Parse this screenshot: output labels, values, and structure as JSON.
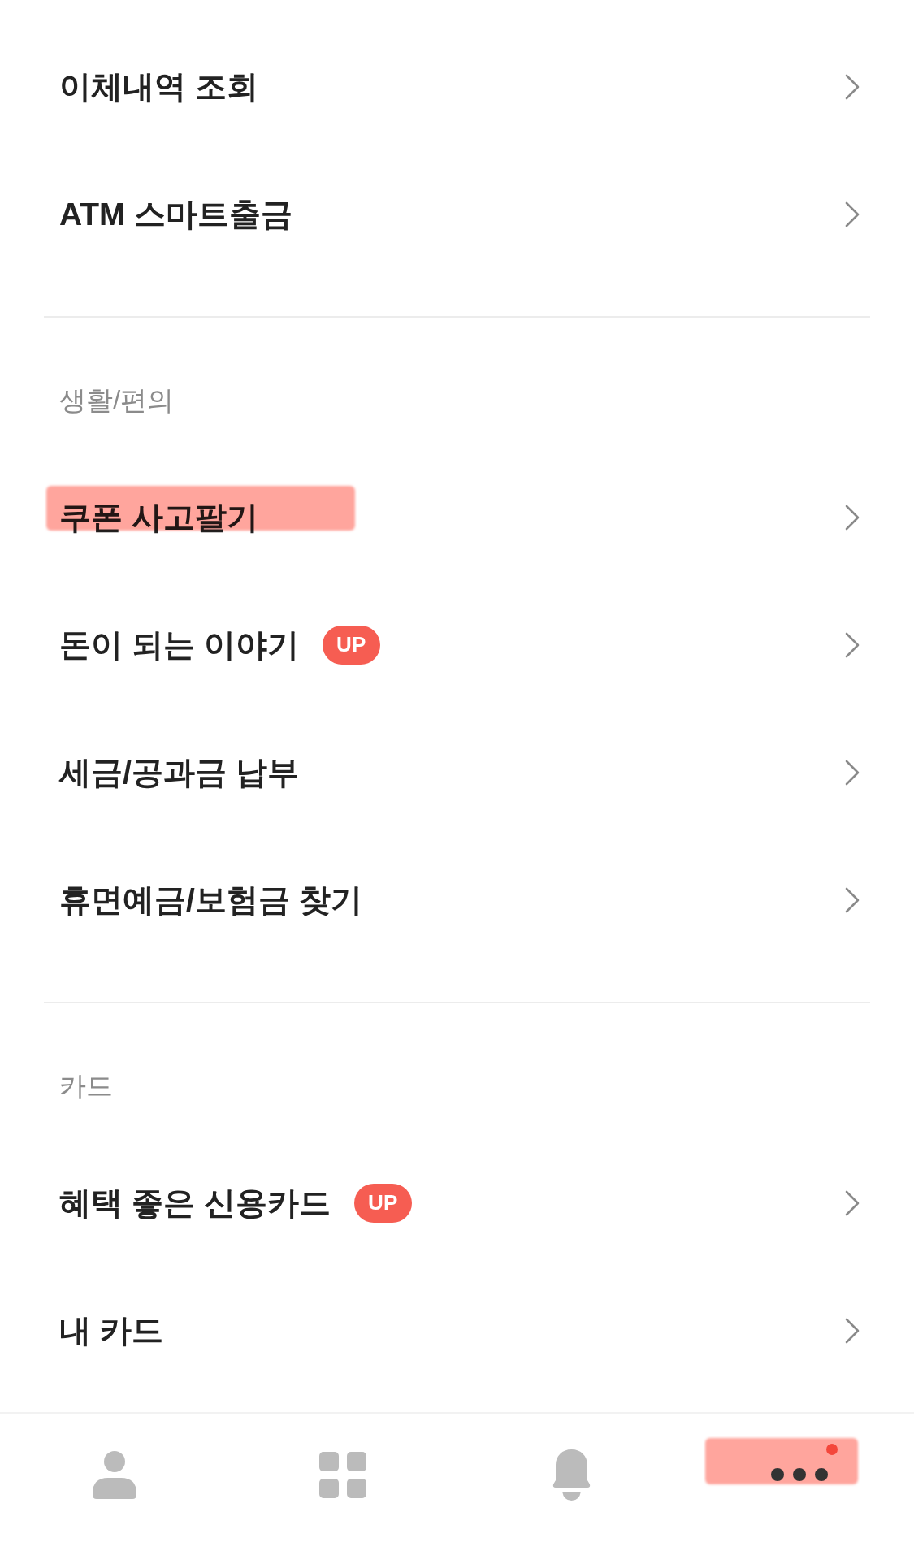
{
  "sections": [
    {
      "items": [
        {
          "label": "이체내역 조회",
          "highlighted": false
        },
        {
          "label": "ATM 스마트출금",
          "highlighted": false
        }
      ]
    },
    {
      "title": "생활/편의",
      "items": [
        {
          "label": "쿠폰 사고팔기",
          "highlighted": true
        },
        {
          "label": "돈이 되는 이야기",
          "badge": "UP",
          "highlighted": false
        },
        {
          "label": "세금/공과금 납부",
          "highlighted": false
        },
        {
          "label": "휴면예금/보험금 찾기",
          "highlighted": false
        }
      ]
    },
    {
      "title": "카드",
      "items": [
        {
          "label": "혜택 좋은 신용카드",
          "badge": "UP",
          "highlighted": false
        },
        {
          "label": "내 카드",
          "highlighted": false
        }
      ]
    }
  ],
  "tab_bar": [
    {
      "kind": "profile",
      "selected": false,
      "dot": false,
      "highlighted": false
    },
    {
      "kind": "apps",
      "selected": false,
      "dot": false,
      "highlighted": false
    },
    {
      "kind": "alerts",
      "selected": false,
      "dot": false,
      "highlighted": false
    },
    {
      "kind": "more",
      "selected": true,
      "dot": true,
      "highlighted": true
    }
  ]
}
